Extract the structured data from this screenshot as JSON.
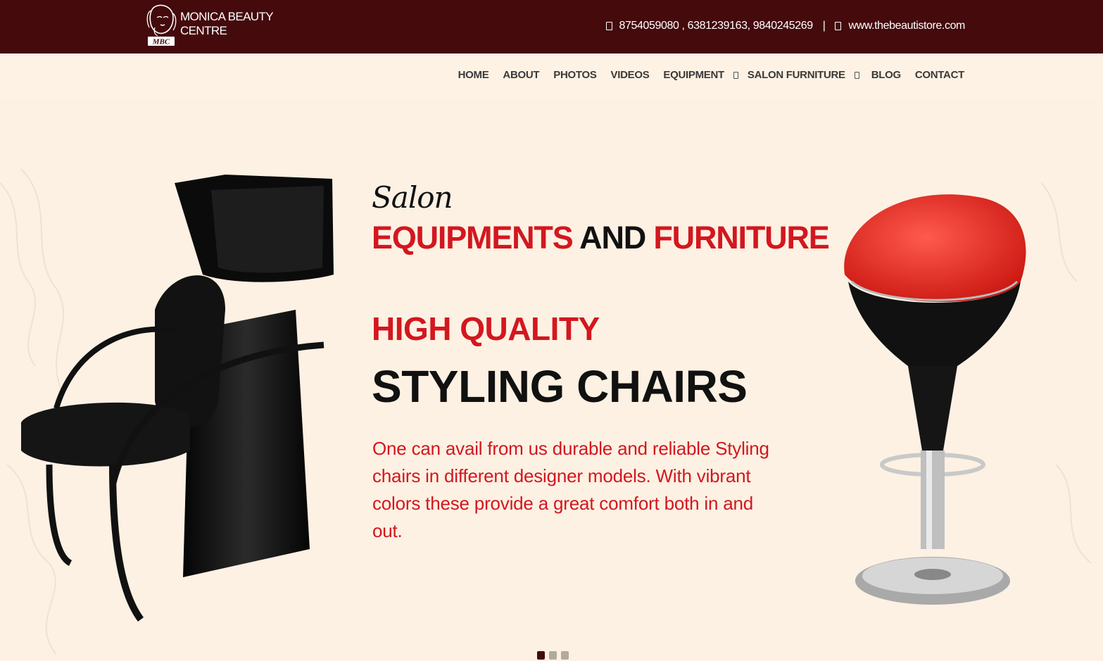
{
  "brand": {
    "name": "MONICA BEAUTY CENTRE",
    "mark": "MBC",
    "color_dark": "#440a0c",
    "color_red": "#d3171f"
  },
  "contact": {
    "phones": "8754059080 , 6381239163, 9840245269",
    "separator": "|",
    "website": "www.thebeautistore.com",
    "phone_icon": "phone-icon",
    "web_icon": "globe-icon"
  },
  "nav": {
    "items": [
      {
        "label": "HOME"
      },
      {
        "label": "ABOUT"
      },
      {
        "label": "PHOTOS"
      },
      {
        "label": "VIDEOS"
      },
      {
        "label": "EQUIPMENT"
      },
      {
        "label": "SALON FURNITURE"
      },
      {
        "label": "BLOG"
      },
      {
        "label": "CONTACT"
      }
    ]
  },
  "hero": {
    "script": "Salon",
    "headline_part1": "EQUIPMENTS",
    "headline_part2": " AND ",
    "headline_part3": "FURNITURE",
    "subhead": "HIGH QUALITY",
    "title": "STYLING CHAIRS",
    "description": "One can avail from us durable and reliable Styling chairs in different designer models. With vibrant colors these provide a great comfort both in and out."
  },
  "slider": {
    "count": 3,
    "active": 1
  }
}
